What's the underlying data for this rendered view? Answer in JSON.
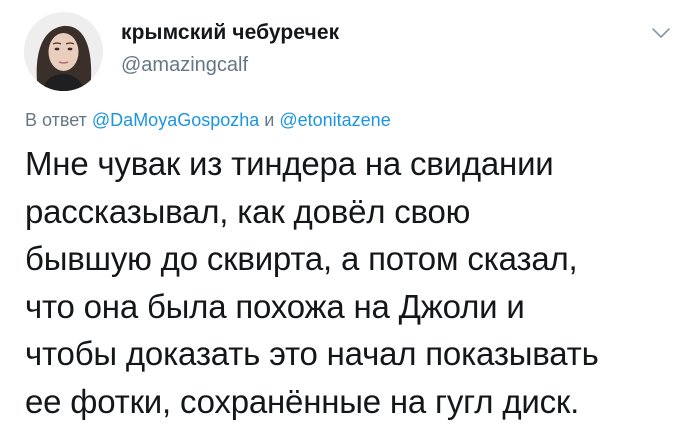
{
  "user": {
    "display_name": "крымский чебуречек",
    "handle": "@amazingcalf"
  },
  "icons": {
    "avatar": "profile-photo",
    "caret": "chevron-down-icon"
  },
  "reply": {
    "prefix": "В ответ",
    "mention_1": "@DaMoyaGospozha",
    "conjunction": "и",
    "mention_2": "@etonitazene"
  },
  "tweet": {
    "lines": [
      "Мне чувак из тиндера на свидании",
      "рассказывал, как довёл свою",
      "бывшую до сквирта, а потом сказал,",
      "что она была похожа на Джоли и",
      "чтобы доказать это начал показывать",
      "ее фотки, сохранённые на гугл диск."
    ]
  },
  "colors": {
    "text": "#14171a",
    "secondary": "#657786",
    "link": "#1b95e0",
    "background": "#ffffff"
  }
}
